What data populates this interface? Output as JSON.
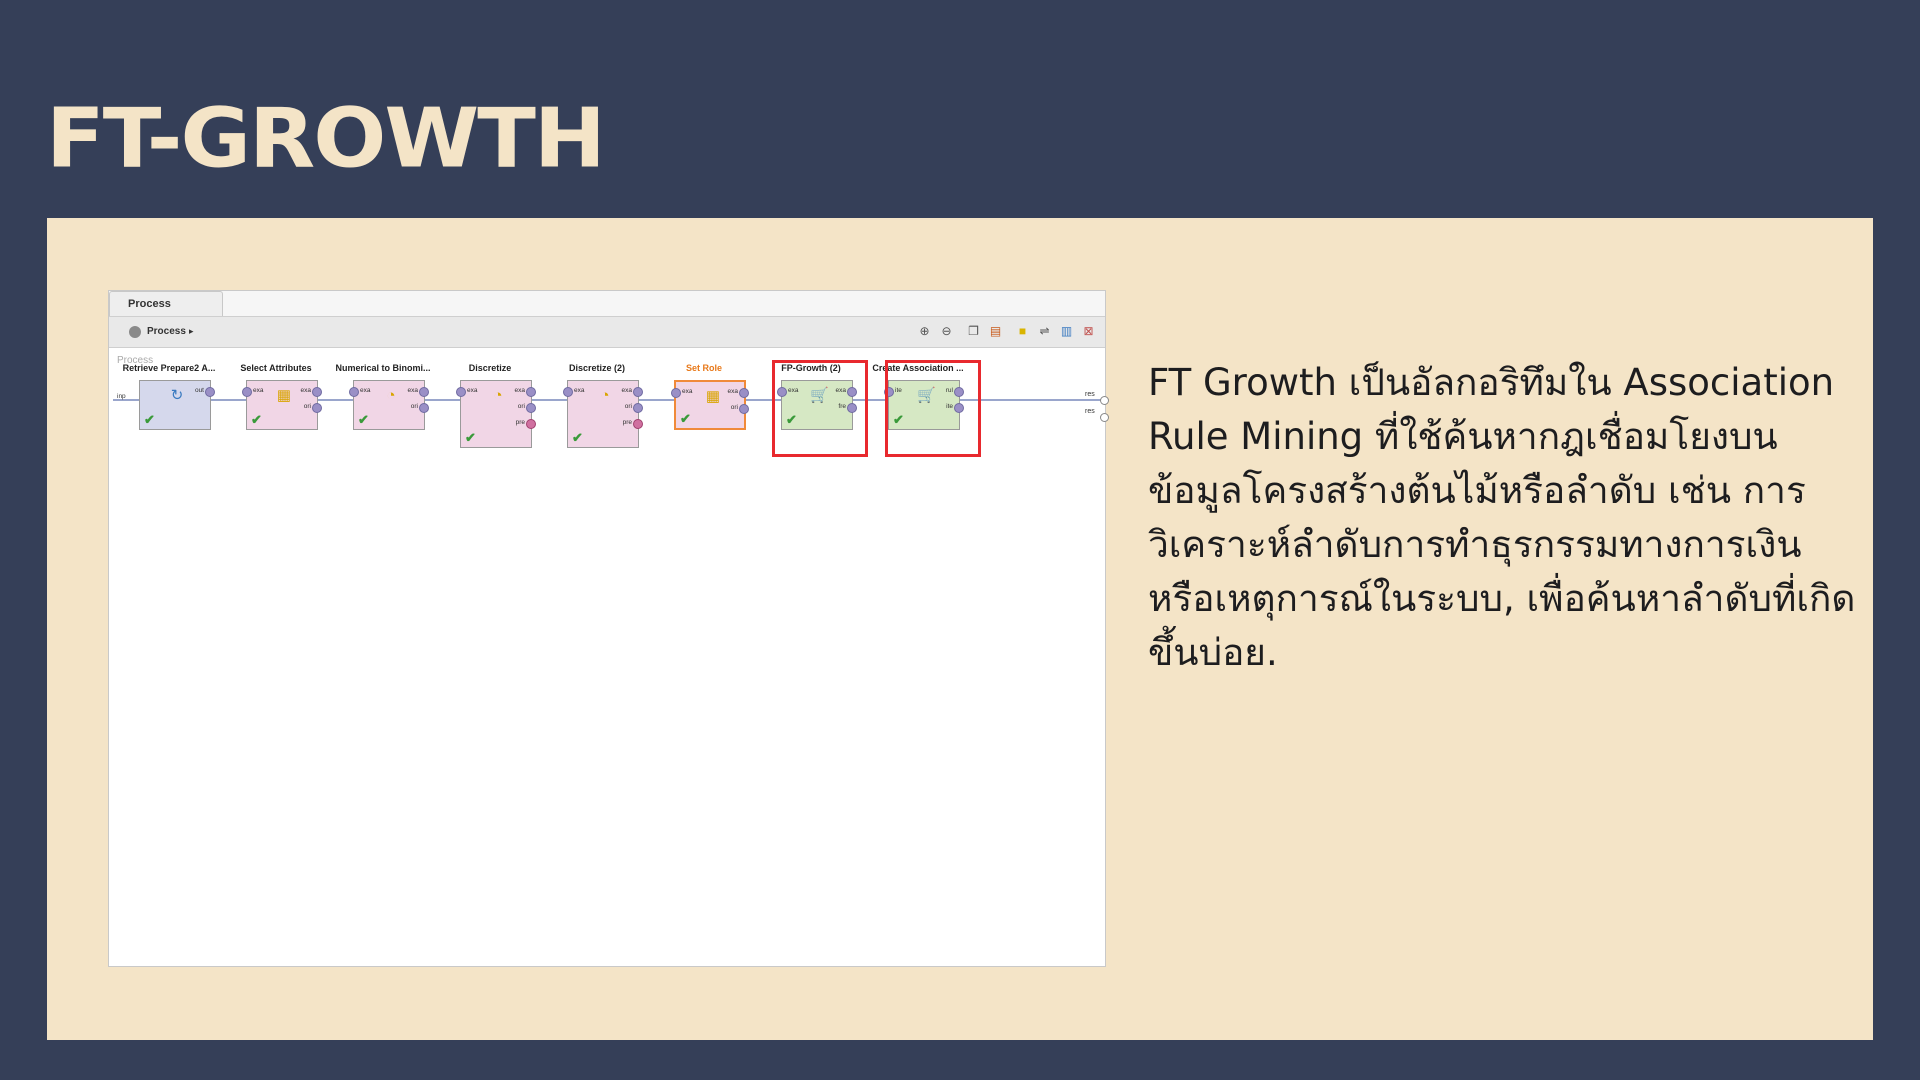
{
  "slide": {
    "title": "FT-GROWTH",
    "description": "FT Growth เป็นอัลกอริทึมใน Association Rule Mining ที่ใช้ค้นหากฎเชื่อมโยงบนข้อมูลโครงสร้างต้นไม้หรือลำดับ เช่น การวิเคราะห์ลำดับการทำธุรกรรมทางการเงิน หรือเหตุการณ์ในระบบ, เพื่อค้นหาลำดับที่เกิดขึ้นบ่อย."
  },
  "screenshot": {
    "tab_label": "Process",
    "breadcrumb": "Process",
    "breadcrumb_arrow": "▸",
    "canvas_label": "Process",
    "process_input_port": "inp",
    "result_ports": [
      "res",
      "res"
    ],
    "toolbar_icons": [
      "zoom-in-icon",
      "zoom-out-icon",
      "copy-icon",
      "paste-icon",
      "note-icon",
      "auto-wire-icon",
      "layout-icon",
      "fit-icon"
    ],
    "operators": [
      {
        "title": "Retrieve Prepare2 A...",
        "color": "blue",
        "in_ports": [],
        "out_ports": [
          "out"
        ],
        "icon": "↻",
        "icon_name": "retrieve-icon",
        "status": "✔"
      },
      {
        "title": "Select Attributes",
        "color": "pink",
        "in_ports": [
          "exa"
        ],
        "out_ports": [
          "exa",
          "ori"
        ],
        "icon": "▦",
        "icon_name": "table-icon",
        "status": "✔"
      },
      {
        "title": "Numerical to Binomi...",
        "color": "pink",
        "in_ports": [
          "exa"
        ],
        "out_ports": [
          "exa",
          "ori"
        ],
        "icon": "◔",
        "icon_name": "convert-icon",
        "status": "✔"
      },
      {
        "title": "Discretize",
        "color": "pink",
        "in_ports": [
          "exa"
        ],
        "out_ports": [
          "exa",
          "ori",
          "pre"
        ],
        "icon": "◔",
        "icon_name": "discretize-icon",
        "status": "✔"
      },
      {
        "title": "Discretize (2)",
        "color": "pink",
        "in_ports": [
          "exa"
        ],
        "out_ports": [
          "exa",
          "ori",
          "pre"
        ],
        "icon": "◔",
        "icon_name": "discretize-icon",
        "status": "✔"
      },
      {
        "title": "Set Role",
        "color": "pink",
        "in_ports": [
          "exa"
        ],
        "out_ports": [
          "exa",
          "ori"
        ],
        "icon": "▦",
        "icon_name": "set-role-icon",
        "status": "✔"
      },
      {
        "title": "FP-Growth (2)",
        "color": "green",
        "in_ports": [
          "exa"
        ],
        "out_ports": [
          "exa",
          "fre"
        ],
        "icon": "🛒",
        "icon_name": "cart-icon",
        "status": "✔"
      },
      {
        "title": "Create Association ...",
        "color": "green",
        "in_ports": [
          "ite"
        ],
        "out_ports": [
          "rul",
          "ite"
        ],
        "icon": "🛒",
        "icon_name": "cart-icon",
        "status": "✔"
      }
    ]
  }
}
